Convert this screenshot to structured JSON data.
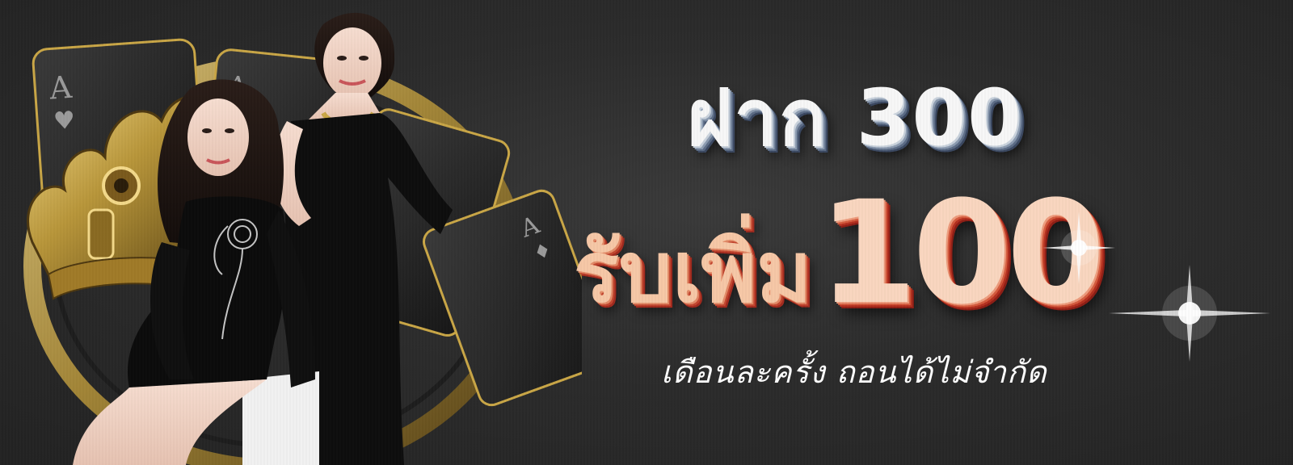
{
  "promo": {
    "deposit_line": "ฝาก 300",
    "receive_text": "รับเพิ่ม",
    "bonus_amount": "100",
    "subtext": "เดือนละครั้ง ถอนได้ไม่จำกัด"
  },
  "colors": {
    "background": "#2c2c2c",
    "deposit_text": "#f7f7f7",
    "deposit_shadow": "#5c6c86",
    "bonus_text": "#f9d6bf",
    "bonus_shadow": "#b3301f",
    "gold": "#b8963a",
    "card_border": "#c9a646"
  },
  "icons": {
    "cards": "ace-playing-card-icon",
    "crown": "golden-crown-icon",
    "sparkle": "light-flare-icon"
  }
}
